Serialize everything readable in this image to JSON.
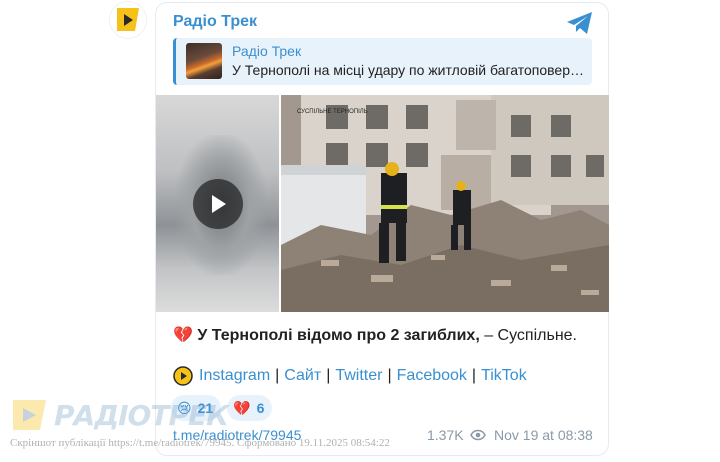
{
  "channel": {
    "name": "Радіо Трек"
  },
  "reply": {
    "title": "Радіо Трек",
    "text": "У Тернополі на місці удару по житловій багатоповер…"
  },
  "media": {
    "photo_watermark": "СУСПІЛЬНЕ ТЕРНОПІЛЬ"
  },
  "post": {
    "emoji": "💔",
    "bold_text": "У Тернополі відомо про 2 загиблих,",
    "rest_text": " – Суспільне."
  },
  "links": {
    "items": [
      "Instagram",
      "Сайт",
      "Twitter",
      "Facebook",
      "TikTok"
    ],
    "separator": "|"
  },
  "reactions": [
    {
      "emoji": "😢",
      "count": "21"
    },
    {
      "emoji": "💔",
      "count": "6"
    }
  ],
  "footer": {
    "post_link": "t.me/radiotrek/79945",
    "views": "1.37K",
    "date": "Nov 19 at 08:38"
  },
  "watermark": {
    "logo_text": "РАДІОТРЕК",
    "caption": "Скріншот публікації https://t.me/radiotrek/79945. Сформовано 19.11.2025 08:54:22"
  },
  "colors": {
    "accent": "#3a8fd0",
    "reply_bg": "#e8f2fb",
    "logo_yellow": "#f6c21a"
  }
}
